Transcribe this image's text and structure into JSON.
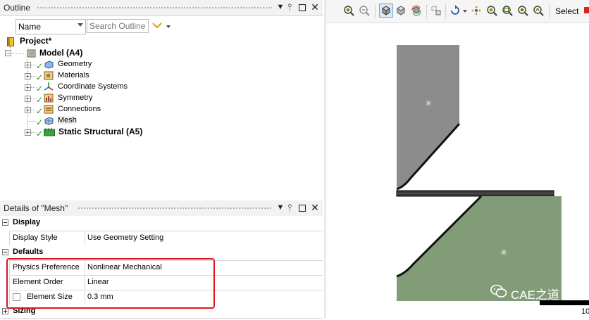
{
  "outline": {
    "title": "Outline",
    "name_combo": "Name",
    "search_placeholder": "Search Outline",
    "tree": {
      "project": "Project*",
      "model": "Model (A4)",
      "children": [
        "Geometry",
        "Materials",
        "Coordinate Systems",
        "Symmetry",
        "Connections",
        "Mesh"
      ],
      "static": "Static Structural (A5)"
    }
  },
  "details": {
    "title": "Details of \"Mesh\"",
    "cat_display": "Display",
    "display_style_label": "Display Style",
    "display_style_value": "Use Geometry Setting",
    "cat_defaults": "Defaults",
    "physics_label": "Physics Preference",
    "physics_value": "Nonlinear Mechanical",
    "order_label": "Element Order",
    "order_value": "Linear",
    "size_label": "Element Size",
    "size_value": "0.3 mm",
    "cat_sizing": "Sizing"
  },
  "toolbar": {
    "select_label": "Select"
  },
  "viewport": {
    "watermark": "CAE之道",
    "corner_text": "10",
    "colors": {
      "upper_body": "#8c8c8c",
      "lower_body": "#839c78",
      "mesh_strip": "#333333"
    }
  },
  "accent": {
    "highlight_box": "#e0141c",
    "check": "#1a9a1a"
  },
  "icons": [
    "zoom-in-icon",
    "zoom-out-icon",
    "iso-view-icon",
    "box-view-icon",
    "rotate-icon",
    "box-select-icon",
    "rotate-arrow-icon",
    "pan-icon",
    "zoom-icon",
    "zoom-box-icon",
    "zoom-fit-icon",
    "zoom-magnify-icon"
  ]
}
